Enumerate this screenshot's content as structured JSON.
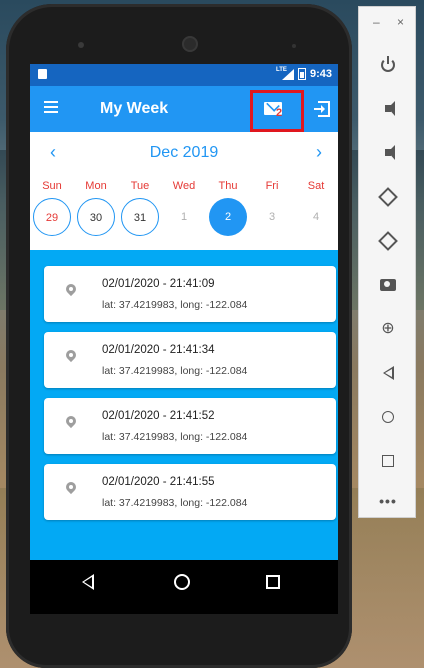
{
  "status_bar": {
    "time": "9:43",
    "network": "LTE"
  },
  "app_bar": {
    "title": "My Week",
    "mail_badge": "2"
  },
  "calendar": {
    "month_label": "Dec 2019",
    "prev_label": "‹",
    "next_label": "›",
    "weekdays": [
      "Sun",
      "Mon",
      "Tue",
      "Wed",
      "Thu",
      "Fri",
      "Sat"
    ],
    "days": [
      "29",
      "30",
      "31",
      "1",
      "2",
      "3",
      "4"
    ],
    "selected_day": "2",
    "colors": {
      "accent": "#2196f3",
      "weekend": "#e53935",
      "muted": "#b0b0b0"
    }
  },
  "entries": [
    {
      "title": "02/01/2020 - 21:41:09",
      "location": "lat: 37.4219983, long: -122.084"
    },
    {
      "title": "02/01/2020 - 21:41:34",
      "location": "lat: 37.4219983, long: -122.084"
    },
    {
      "title": "02/01/2020 - 21:41:52",
      "location": "lat: 37.4219983, long: -122.084"
    },
    {
      "title": "02/01/2020 - 21:41:55",
      "location": "lat: 37.4219983, long: -122.084"
    }
  ],
  "emulator_toolbar": {
    "minimize_label": "–",
    "close_label": "×",
    "buttons": [
      "power-icon",
      "volume-up-icon",
      "volume-down-icon",
      "rotate-left-icon",
      "rotate-right-icon",
      "camera-icon",
      "zoom-icon",
      "back-icon",
      "home-icon",
      "overview-icon",
      "more-icon"
    ],
    "more_label": "•••",
    "zoom_label": "⊕"
  },
  "theme": {
    "app_bar": "#2196f3",
    "status_bar": "#1565c0",
    "list_bg": "#03a9f4",
    "highlight_box": "#e0171e"
  }
}
